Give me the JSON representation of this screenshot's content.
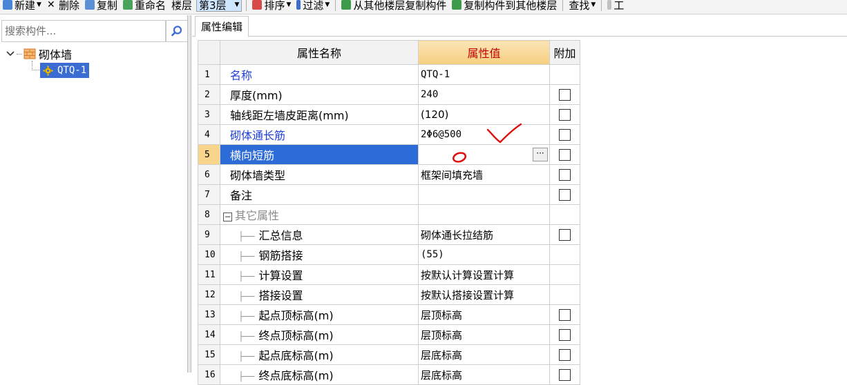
{
  "toolbar": {
    "new_label": "新建",
    "delete_label": "删除",
    "copy_label": "复制",
    "rename_label": "重命名",
    "floor_label": "楼层",
    "floor_value": "第3层",
    "sort_label": "排序",
    "filter_label": "过滤",
    "copy_from_floor_label": "从其他楼层复制构件",
    "copy_to_floor_label": "复制构件到其他楼层",
    "find_label": "查找",
    "more_label": "工"
  },
  "left": {
    "search_placeholder": "搜索构件...",
    "tree_parent": "砌体墙",
    "tree_child": "QTQ-1"
  },
  "tab": {
    "label": "属性编辑"
  },
  "grid": {
    "headers": {
      "name": "属性名称",
      "value": "属性值",
      "add": "附加"
    },
    "rows": [
      {
        "num": "1",
        "name": "名称",
        "value": "QTQ-1",
        "checkbox": false
      },
      {
        "num": "2",
        "name": "厚度(mm)",
        "value": "240",
        "checkbox": true
      },
      {
        "num": "3",
        "name": "轴线距左墙皮距离(mm)",
        "value": "(120)",
        "checkbox": true
      },
      {
        "num": "4",
        "name": "砌体通长筋",
        "value": "2Φ6@500",
        "checkbox": true
      },
      {
        "num": "5",
        "name": "横向短筋",
        "value": "",
        "checkbox": true
      },
      {
        "num": "6",
        "name": "砌体墙类型",
        "value": "框架间填充墙",
        "checkbox": true
      },
      {
        "num": "7",
        "name": "备注",
        "value": "",
        "checkbox": true
      },
      {
        "num": "8",
        "name": "其它属性",
        "value": "",
        "checkbox": false
      },
      {
        "num": "9",
        "name": "汇总信息",
        "value": "砌体通长拉结筋",
        "checkbox": true
      },
      {
        "num": "10",
        "name": "钢筋搭接",
        "value": "(55)",
        "checkbox": false
      },
      {
        "num": "11",
        "name": "计算设置",
        "value": "按默认计算设置计算",
        "checkbox": false
      },
      {
        "num": "12",
        "name": "搭接设置",
        "value": "按默认搭接设置计算",
        "checkbox": false
      },
      {
        "num": "13",
        "name": "起点顶标高(m)",
        "value": "层顶标高",
        "checkbox": true
      },
      {
        "num": "14",
        "name": "终点顶标高(m)",
        "value": "层顶标高",
        "checkbox": true
      },
      {
        "num": "15",
        "name": "起点底标高(m)",
        "value": "层底标高",
        "checkbox": true
      },
      {
        "num": "16",
        "name": "终点底标高(m)",
        "value": "层底标高",
        "checkbox": true
      }
    ],
    "ellipsis": "···"
  },
  "colors": {
    "selection_blue": "#2d6bd6",
    "link_blue": "#1f3fd6",
    "header_value_red": "#c00000",
    "annotation_red": "#e01010"
  }
}
